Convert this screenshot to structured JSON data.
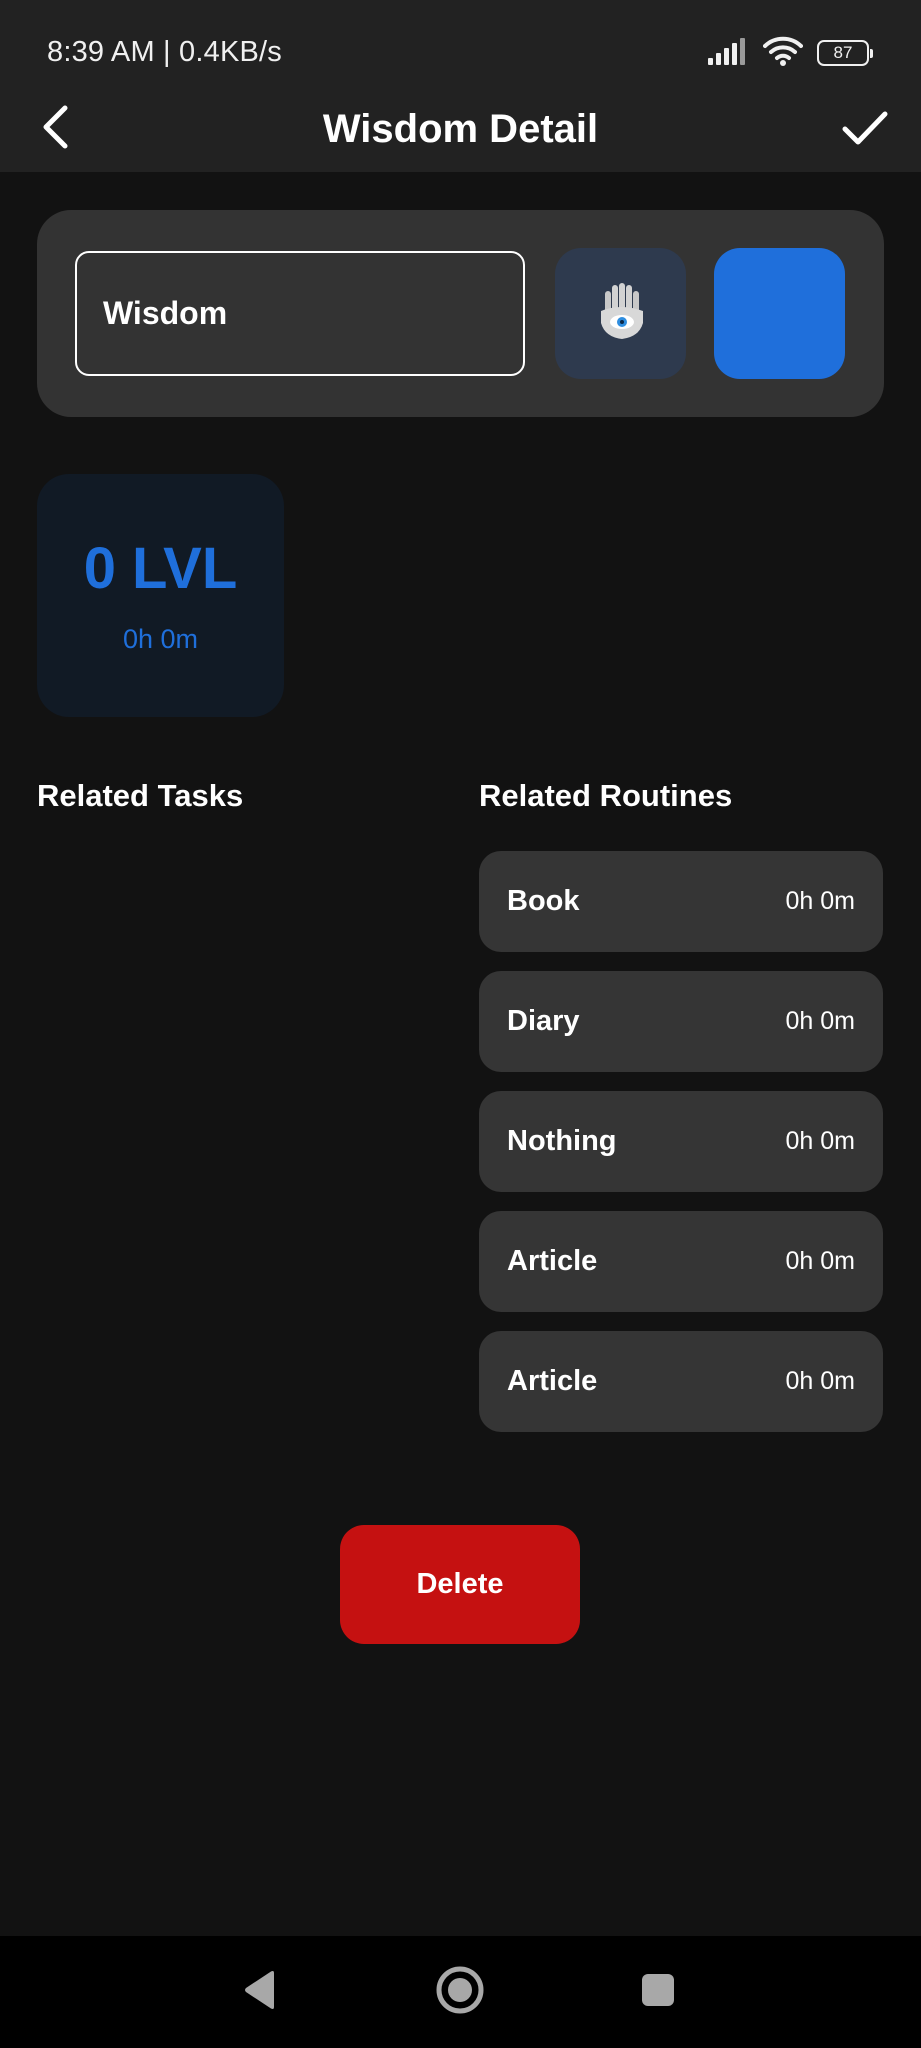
{
  "status_bar": {
    "time_speed": "8:39 AM | 0.4KB/s",
    "battery": "87",
    "icons": [
      "signal-icon",
      "wifi-icon",
      "battery-icon"
    ]
  },
  "app_bar": {
    "title": "Wisdom Detail",
    "back_icon": "chevron-left-icon",
    "confirm_icon": "check-icon"
  },
  "attribute": {
    "name": "Wisdom",
    "icon": "hamsa-icon",
    "color": "#1f6fdb"
  },
  "level": {
    "label": "0 LVL",
    "time": "0h 0m",
    "accent": "#1f6fdb"
  },
  "sections": {
    "related_tasks": "Related Tasks",
    "related_routines": "Related Routines"
  },
  "routines": [
    {
      "name": "Book",
      "time": "0h 0m"
    },
    {
      "name": "Diary",
      "time": "0h 0m"
    },
    {
      "name": "Nothing",
      "time": "0h 0m"
    },
    {
      "name": "Article",
      "time": "0h 0m"
    },
    {
      "name": "Article",
      "time": "0h 0m"
    }
  ],
  "actions": {
    "delete_label": "Delete",
    "delete_color": "#c51111"
  },
  "nav_bar": {
    "icons": [
      "back-triangle-icon",
      "home-circle-icon",
      "recents-square-icon"
    ]
  }
}
